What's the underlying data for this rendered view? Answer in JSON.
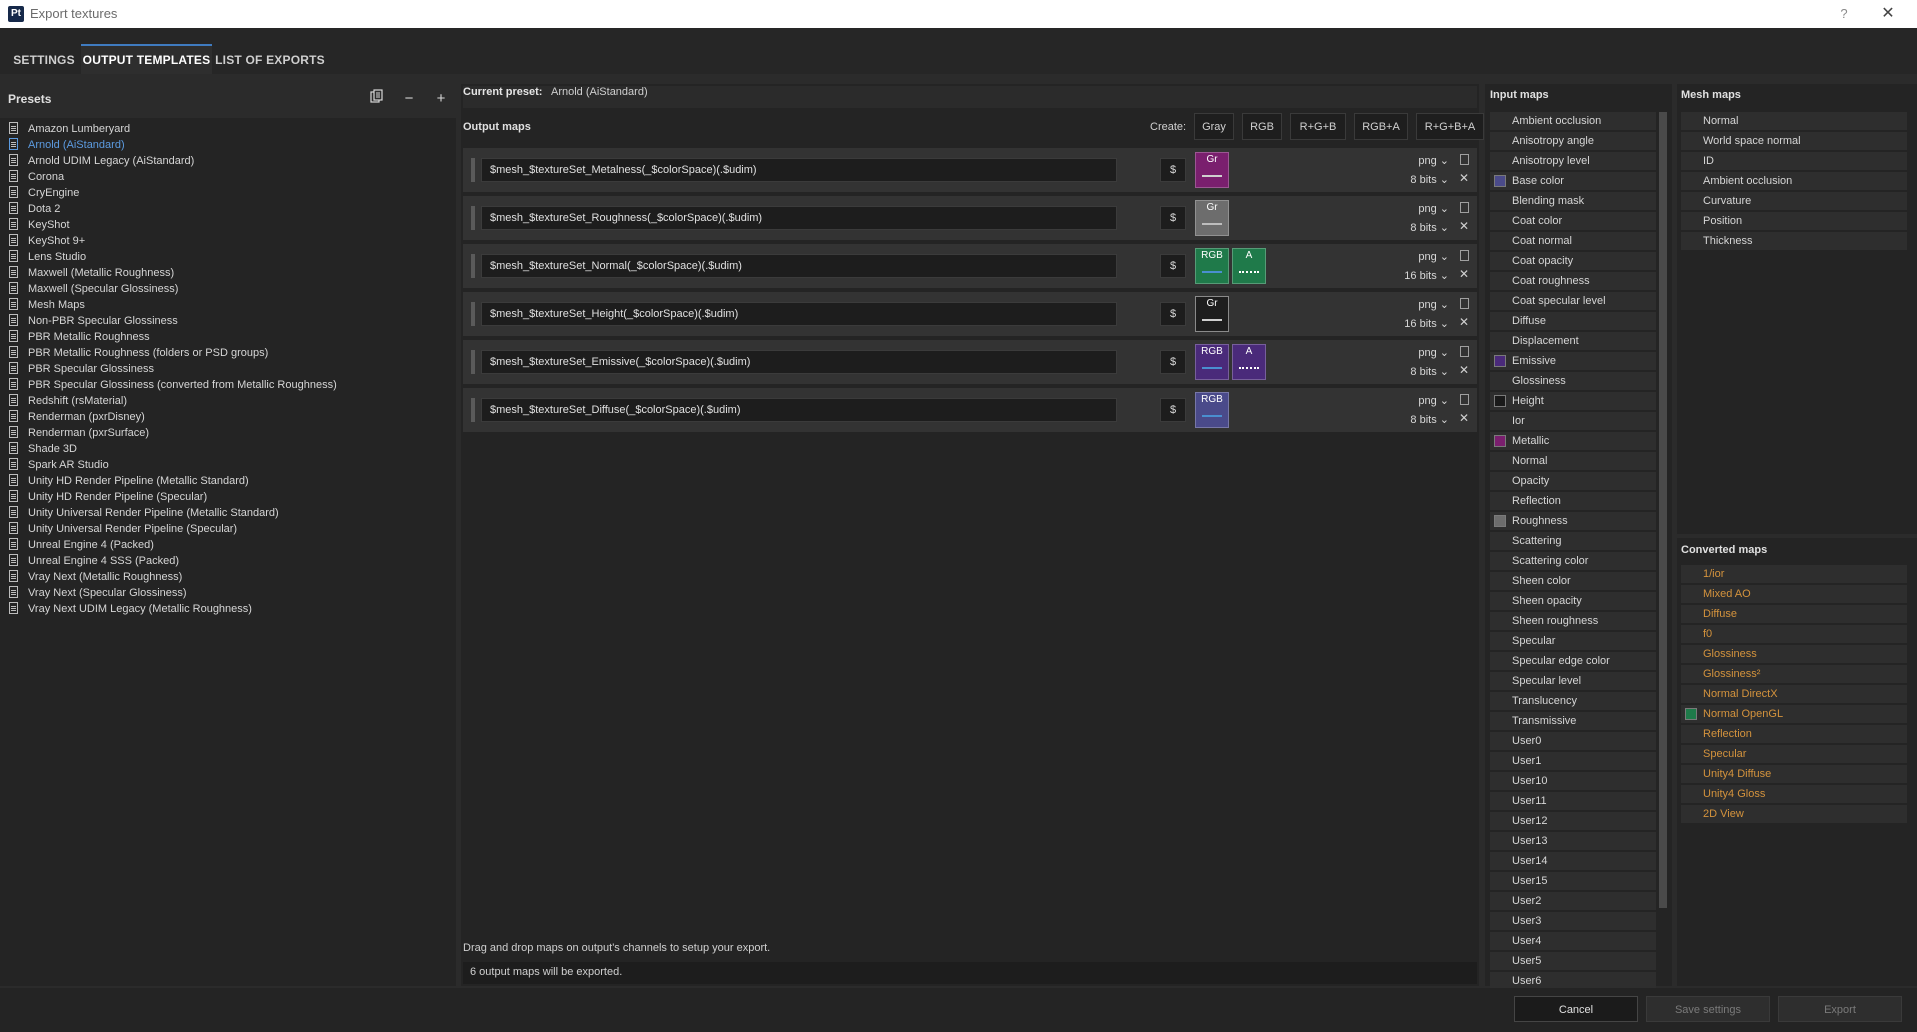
{
  "window": {
    "title": "Export textures",
    "logo_text": "Pt",
    "help_glyph": "?",
    "close_glyph": "✕"
  },
  "tabs": [
    {
      "label": "SETTINGS"
    },
    {
      "label": "OUTPUT TEMPLATES"
    },
    {
      "label": "LIST OF EXPORTS"
    }
  ],
  "presets": {
    "title": "Presets",
    "icons": [
      "copy-icon",
      "minus-icon",
      "plus-icon"
    ],
    "items": [
      "Amazon Lumberyard",
      "Arnold (AiStandard)",
      "Arnold UDIM Legacy (AiStandard)",
      "Corona",
      "CryEngine",
      "Dota 2",
      "KeyShot",
      "KeyShot 9+",
      "Lens Studio",
      "Maxwell (Metallic Roughness)",
      "Maxwell (Specular Glossiness)",
      "Mesh Maps",
      "Non-PBR Specular Glossiness",
      "PBR Metallic Roughness",
      "PBR Metallic Roughness (folders or PSD groups)",
      "PBR Specular Glossiness",
      "PBR Specular Glossiness (converted from Metallic Roughness)",
      "Redshift (rsMaterial)",
      "Renderman (pxrDisney)",
      "Renderman (pxrSurface)",
      "Shade 3D",
      "Spark AR Studio",
      "Unity HD Render Pipeline (Metallic Standard)",
      "Unity HD Render Pipeline (Specular)",
      "Unity Universal Render Pipeline (Metallic Standard)",
      "Unity Universal Render Pipeline (Specular)",
      "Unreal Engine 4 (Packed)",
      "Unreal Engine 4 SSS (Packed)",
      "Vray Next (Metallic Roughness)",
      "Vray Next (Specular Glossiness)",
      "Vray Next UDIM Legacy (Metallic Roughness)"
    ],
    "selected": "Arnold (AiStandard)"
  },
  "center": {
    "current_preset_label": "Current preset:",
    "current_preset_value": "Arnold (AiStandard)",
    "output_maps_title": "Output maps",
    "create_label": "Create:",
    "create_buttons": [
      "Gray",
      "RGB",
      "R+G+B",
      "RGB+A",
      "R+G+B+A"
    ],
    "dollar": "$",
    "output_maps": [
      {
        "name": "$mesh_$textureSet_Metalness(_$colorSpace)(.$udim)",
        "format": "png",
        "bits": "8 bits",
        "channels": [
          {
            "label": "Gr",
            "color": "#7a1f6e",
            "bar": "#cfcfcf"
          }
        ]
      },
      {
        "name": "$mesh_$textureSet_Roughness(_$colorSpace)(.$udim)",
        "format": "png",
        "bits": "8 bits",
        "channels": [
          {
            "label": "Gr",
            "color": "#6d6d6d",
            "bar": "#bdbdbd"
          }
        ]
      },
      {
        "name": "$mesh_$textureSet_Normal(_$colorSpace)(.$udim)",
        "format": "png",
        "bits": "16 bits",
        "channels": [
          {
            "label": "RGB",
            "color": "#1f7a4a",
            "bar": "#4a8fd0"
          },
          {
            "label": "A",
            "color": "#1f7a4a",
            "bar": "#ffffff"
          }
        ]
      },
      {
        "name": "$mesh_$textureSet_Height(_$colorSpace)(.$udim)",
        "format": "png",
        "bits": "16 bits",
        "channels": [
          {
            "label": "Gr",
            "color": "#1e1e1e",
            "bar": "#d0d0d0"
          }
        ]
      },
      {
        "name": "$mesh_$textureSet_Emissive(_$colorSpace)(.$udim)",
        "format": "png",
        "bits": "8 bits",
        "channels": [
          {
            "label": "RGB",
            "color": "#4a2a7a",
            "bar": "#4a8fd0"
          },
          {
            "label": "A",
            "color": "#4a2a7a",
            "bar": "#ffffff"
          }
        ]
      },
      {
        "name": "$mesh_$textureSet_Diffuse(_$colorSpace)(.$udim)",
        "format": "png",
        "bits": "8 bits",
        "channels": [
          {
            "label": "RGB",
            "color": "#4a4a8a",
            "bar": "#4a8fd0"
          }
        ]
      }
    ],
    "drag_hint": "Drag and drop maps on output's channels to setup your export.",
    "export_count": "6 output maps will be exported."
  },
  "input_maps": {
    "title": "Input maps",
    "items": [
      {
        "label": "Ambient occlusion",
        "swatch": ""
      },
      {
        "label": "Anisotropy angle",
        "swatch": ""
      },
      {
        "label": "Anisotropy level",
        "swatch": ""
      },
      {
        "label": "Base color",
        "swatch": "#4b4b8a"
      },
      {
        "label": "Blending mask",
        "swatch": ""
      },
      {
        "label": "Coat color",
        "swatch": ""
      },
      {
        "label": "Coat normal",
        "swatch": ""
      },
      {
        "label": "Coat opacity",
        "swatch": ""
      },
      {
        "label": "Coat roughness",
        "swatch": ""
      },
      {
        "label": "Coat specular level",
        "swatch": ""
      },
      {
        "label": "Diffuse",
        "swatch": ""
      },
      {
        "label": "Displacement",
        "swatch": ""
      },
      {
        "label": "Emissive",
        "swatch": "#4a2a7a"
      },
      {
        "label": "Glossiness",
        "swatch": ""
      },
      {
        "label": "Height",
        "swatch": "#1a1a1a"
      },
      {
        "label": "Ior",
        "swatch": ""
      },
      {
        "label": "Metallic",
        "swatch": "#7a1f6e"
      },
      {
        "label": "Normal",
        "swatch": ""
      },
      {
        "label": "Opacity",
        "swatch": ""
      },
      {
        "label": "Reflection",
        "swatch": ""
      },
      {
        "label": "Roughness",
        "swatch": "#6d6d6d"
      },
      {
        "label": "Scattering",
        "swatch": ""
      },
      {
        "label": "Scattering color",
        "swatch": ""
      },
      {
        "label": "Sheen color",
        "swatch": ""
      },
      {
        "label": "Sheen opacity",
        "swatch": ""
      },
      {
        "label": "Sheen roughness",
        "swatch": ""
      },
      {
        "label": "Specular",
        "swatch": ""
      },
      {
        "label": "Specular edge color",
        "swatch": ""
      },
      {
        "label": "Specular level",
        "swatch": ""
      },
      {
        "label": "Translucency",
        "swatch": ""
      },
      {
        "label": "Transmissive",
        "swatch": ""
      },
      {
        "label": "User0",
        "swatch": ""
      },
      {
        "label": "User1",
        "swatch": ""
      },
      {
        "label": "User10",
        "swatch": ""
      },
      {
        "label": "User11",
        "swatch": ""
      },
      {
        "label": "User12",
        "swatch": ""
      },
      {
        "label": "User13",
        "swatch": ""
      },
      {
        "label": "User14",
        "swatch": ""
      },
      {
        "label": "User15",
        "swatch": ""
      },
      {
        "label": "User2",
        "swatch": ""
      },
      {
        "label": "User3",
        "swatch": ""
      },
      {
        "label": "User4",
        "swatch": ""
      },
      {
        "label": "User5",
        "swatch": ""
      },
      {
        "label": "User6",
        "swatch": ""
      }
    ]
  },
  "mesh_maps": {
    "title": "Mesh maps",
    "items": [
      "Normal",
      "World space normal",
      "ID",
      "Ambient occlusion",
      "Curvature",
      "Position",
      "Thickness"
    ]
  },
  "converted_maps": {
    "title": "Converted maps",
    "items": [
      {
        "label": "1/ior",
        "swatch": ""
      },
      {
        "label": "Mixed AO",
        "swatch": ""
      },
      {
        "label": "Diffuse",
        "swatch": ""
      },
      {
        "label": "f0",
        "swatch": ""
      },
      {
        "label": "Glossiness",
        "swatch": ""
      },
      {
        "label": "Glossiness²",
        "swatch": ""
      },
      {
        "label": "Normal DirectX",
        "swatch": ""
      },
      {
        "label": "Normal OpenGL",
        "swatch": "#1f7a4a"
      },
      {
        "label": "Reflection",
        "swatch": ""
      },
      {
        "label": "Specular",
        "swatch": ""
      },
      {
        "label": "Unity4 Diffuse",
        "swatch": ""
      },
      {
        "label": "Unity4 Gloss",
        "swatch": ""
      },
      {
        "label": "2D View",
        "swatch": ""
      }
    ]
  },
  "footer": {
    "cancel": "Cancel",
    "save": "Save settings",
    "export": "Export"
  }
}
